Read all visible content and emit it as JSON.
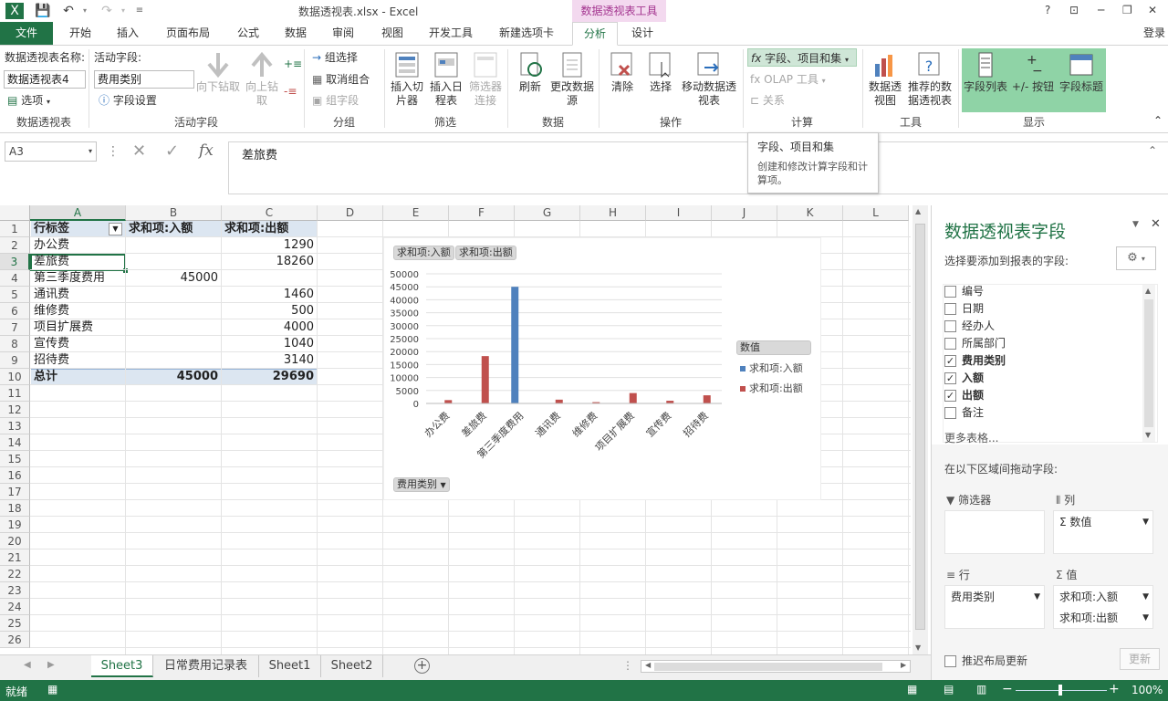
{
  "window": {
    "title": "数据透视表.xlsx - Excel",
    "context_tab": "数据透视表工具",
    "help": "?",
    "signin": "登录"
  },
  "tabs": [
    "文件",
    "开始",
    "插入",
    "页面布局",
    "公式",
    "数据",
    "审阅",
    "视图",
    "开发工具",
    "新建选项卡",
    "分析",
    "设计"
  ],
  "ribbon": {
    "pivot_name_label": "数据透视表名称:",
    "pivot_name_value": "数据透视表4",
    "options_label": "选项",
    "group_pivot": "数据透视表",
    "active_field_label": "活动字段:",
    "active_field_value": "费用类别",
    "field_settings": "字段设置",
    "drill_down": "向下钻取",
    "drill_up": "向上钻取",
    "group_active": "活动字段",
    "group_selection": "组选择",
    "ungroup": "取消组合",
    "group_field": "组字段",
    "group_group": "分组",
    "insert_slicer": "插入切片器",
    "insert_timeline": "插入日程表",
    "filter_connections": "筛选器连接",
    "group_filter": "筛选",
    "refresh": "刷新",
    "change_source": "更改数据源",
    "group_data": "数据",
    "clear": "清除",
    "select": "选择",
    "move_pivot": "移动数据透视表",
    "group_actions": "操作",
    "fields_items_sets": "字段、项目和集",
    "olap_tools": "OLAP 工具",
    "relationships": "关系",
    "group_calc": "计算",
    "pivot_chart": "数据透视图",
    "recommended": "推荐的数据透视表",
    "group_tools": "工具",
    "field_list": "字段列表",
    "plus_minus": "+/- 按钮",
    "field_headers": "字段标题",
    "group_show": "显示"
  },
  "tooltip": {
    "title": "字段、项目和集",
    "body": "创建和修改计算字段和计算项。"
  },
  "formula_bar": {
    "name_box": "A3",
    "content": "差旅费"
  },
  "columns": [
    "A",
    "B",
    "C",
    "D",
    "E",
    "F",
    "G",
    "H",
    "I",
    "J",
    "K",
    "L"
  ],
  "rows": [
    "1",
    "2",
    "3",
    "4",
    "5",
    "6",
    "7",
    "8",
    "9",
    "10",
    "11",
    "12",
    "13",
    "14",
    "15",
    "16",
    "17",
    "18",
    "19",
    "20",
    "21",
    "22",
    "23",
    "24",
    "25",
    "26"
  ],
  "pivot": {
    "header": [
      "行标签",
      "求和项:入额",
      "求和项:出额"
    ],
    "rows": [
      {
        "label": "办公费",
        "in": "",
        "out": "1290"
      },
      {
        "label": "差旅费",
        "in": "",
        "out": "18260"
      },
      {
        "label": "第三季度费用",
        "in": "45000",
        "out": ""
      },
      {
        "label": "通讯费",
        "in": "",
        "out": "1460"
      },
      {
        "label": "维修费",
        "in": "",
        "out": "500"
      },
      {
        "label": "项目扩展费",
        "in": "",
        "out": "4000"
      },
      {
        "label": "宣传费",
        "in": "",
        "out": "1040"
      },
      {
        "label": "招待费",
        "in": "",
        "out": "3140"
      }
    ],
    "total": {
      "label": "总计",
      "in": "45000",
      "out": "29690"
    }
  },
  "chart_data": {
    "type": "bar",
    "categories": [
      "办公费",
      "差旅费",
      "第三季度费用",
      "通讯费",
      "维修费",
      "项目扩展费",
      "宣传费",
      "招待费"
    ],
    "series": [
      {
        "name": "求和项:入额",
        "color": "#4f81bd",
        "values": [
          0,
          0,
          45000,
          0,
          0,
          0,
          0,
          0
        ]
      },
      {
        "name": "求和项:出额",
        "color": "#c0504d",
        "values": [
          1290,
          18260,
          0,
          1460,
          500,
          4000,
          1040,
          3140
        ]
      }
    ],
    "ylim": [
      0,
      50000
    ],
    "yticks": [
      "50000",
      "45000",
      "40000",
      "35000",
      "30000",
      "25000",
      "20000",
      "15000",
      "10000",
      "5000",
      "0"
    ],
    "legend_title": "数值",
    "legend_position": "right",
    "field_buttons": [
      "求和项:入额",
      "求和项:出额"
    ],
    "axis_field_button": "费用类别"
  },
  "sheets": [
    "Sheet3",
    "日常费用记录表",
    "Sheet1",
    "Sheet2"
  ],
  "status": {
    "ready": "就绪",
    "zoom": "100%"
  },
  "pane": {
    "title": "数据透视表字段",
    "subtitle": "选择要添加到报表的字段:",
    "fields": [
      {
        "name": "编号",
        "checked": false
      },
      {
        "name": "日期",
        "checked": false
      },
      {
        "name": "经办人",
        "checked": false
      },
      {
        "name": "所属部门",
        "checked": false
      },
      {
        "name": "费用类别",
        "checked": true
      },
      {
        "name": "入额",
        "checked": true
      },
      {
        "name": "出额",
        "checked": true
      },
      {
        "name": "备注",
        "checked": false
      }
    ],
    "more_tables": "更多表格...",
    "drag_hint": "在以下区域间拖动字段:",
    "filters": "筛选器",
    "columns": "列",
    "rows": "行",
    "values": "值",
    "col_item": "Σ 数值",
    "row_item": "费用类别",
    "value_items": [
      "求和项:入额",
      "求和项:出额"
    ],
    "defer": "推迟布局更新",
    "update": "更新"
  }
}
